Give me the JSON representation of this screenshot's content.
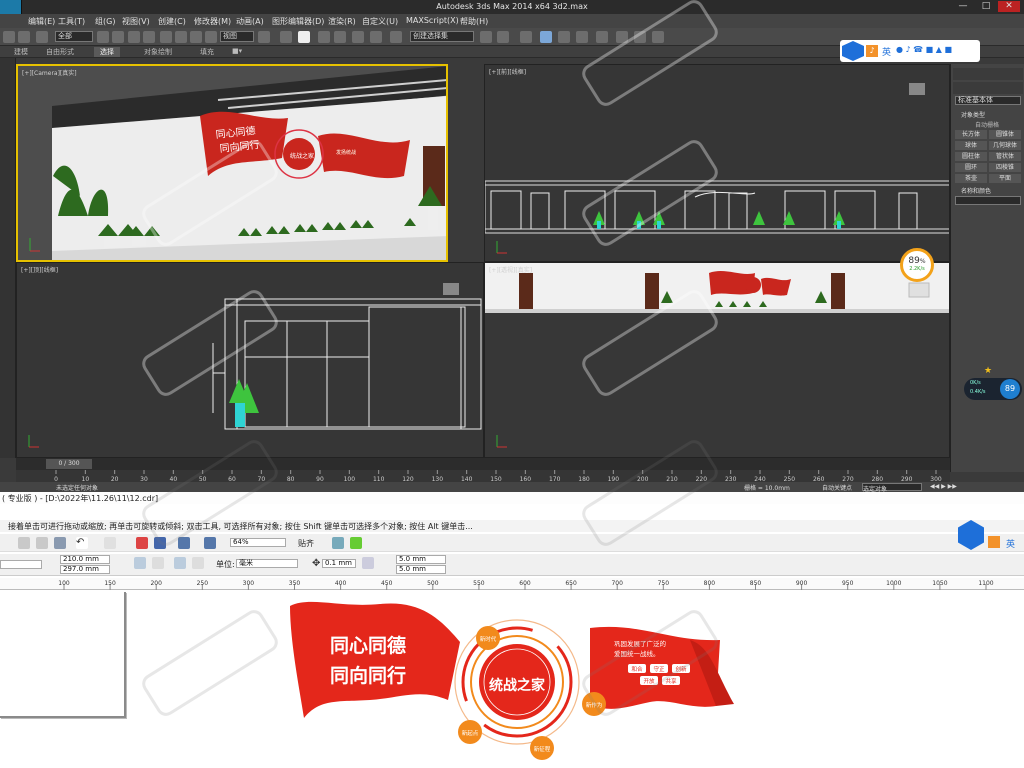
{
  "max": {
    "window_title": "Autodesk 3ds Max  2014 x64     3d2.max",
    "menu": [
      "编辑(E)",
      "工具(T)",
      "组(G)",
      "视图(V)",
      "创建(C)",
      "修改器(M)",
      "动画(A)",
      "图形编辑器(D)",
      "渲染(R)",
      "自定义(U)",
      "MAXScript(X)",
      "帮助(H)"
    ],
    "toolbar": {
      "selection_set": "全部",
      "ref_coord": "视图",
      "named_sel": "创建选择集"
    },
    "ribbon": [
      "建模",
      "自由形式",
      "选择",
      "对象绘制",
      "填充"
    ],
    "viewports": {
      "camera": "[+][Camera][真实]",
      "front": "[+][前][线框]",
      "top": "[+][顶][线框]",
      "perspective": "[+][透视][真实]"
    },
    "wall_sign": {
      "line1": "同心同德",
      "line2": "同向同行",
      "center": "统战之家",
      "sub": "发扬统战"
    },
    "cmd_panel": {
      "dropdown": "标准基本体",
      "rollout_type": "对象类型",
      "auto_grid": "自动栅格",
      "prims": [
        "长方体",
        "圆锥体",
        "球体",
        "几何球体",
        "圆柱体",
        "管状体",
        "圆环",
        "四棱锥",
        "茶壶",
        "平面"
      ],
      "rollout_name": "名称和颜色"
    },
    "timeline": {
      "frame": "0 / 300",
      "ticks": [
        "0",
        "10",
        "20",
        "30",
        "40",
        "50",
        "60",
        "70",
        "80",
        "90",
        "100",
        "110",
        "120",
        "130",
        "140",
        "150",
        "160",
        "170",
        "180",
        "190",
        "200",
        "210",
        "220",
        "230",
        "240",
        "250",
        "260",
        "270",
        "280",
        "290",
        "300"
      ]
    },
    "status": {
      "left": "未选定任何对象",
      "grid": "栅格 = 10.0mm",
      "autokey": "自动关键点",
      "sel_obj": "选定对象"
    }
  },
  "widgets": {
    "ime_label": "英",
    "perf_value": "89",
    "perf_unit": "%",
    "perf_rate": "2.2K/s",
    "net_up": "0K/s",
    "net_down": "0.4K/s",
    "perf_value2": "89"
  },
  "corel": {
    "title": "( 专业版 ) - [D:\\2022年\\11.26\\11\\12.cdr]",
    "hint": "接着单击可进行拖动或缩放; 再单击可旋转或倾斜; 双击工具, 可选择所有对象; 按住 Shift 键单击可选择多个对象; 按住 Alt 键单击...",
    "zoom": "64%",
    "snap": "贴齐",
    "ime": "英",
    "width": "210.0 mm",
    "height": "297.0 mm",
    "units_label": "单位:",
    "units": "毫米",
    "nudge": "0.1 mm",
    "dup_x": "5.0 mm",
    "dup_y": "5.0 mm",
    "ruler": [
      "100",
      "150",
      "200",
      "250",
      "300",
      "350",
      "400",
      "450",
      "500",
      "550",
      "600",
      "650",
      "700",
      "750",
      "800",
      "850",
      "900",
      "950",
      "1000",
      "1050",
      "1100"
    ]
  },
  "artwork": {
    "line1": "同心同德",
    "line2": "同向同行",
    "center": "统战之家",
    "body_line1": "巩固发展了广泛的",
    "body_line2": "爱国统一战线。",
    "chips": [
      "和合",
      "守正",
      "创新",
      "开放",
      "共享"
    ],
    "nodes": [
      "新时代",
      "新作为",
      "新征程",
      "新起点"
    ]
  },
  "colors": {
    "red": "#d8261c",
    "orange": "#f28a1c",
    "max_bg": "#3a3a3a",
    "viewport_bg": "#373737",
    "accent": "#e6c100"
  }
}
